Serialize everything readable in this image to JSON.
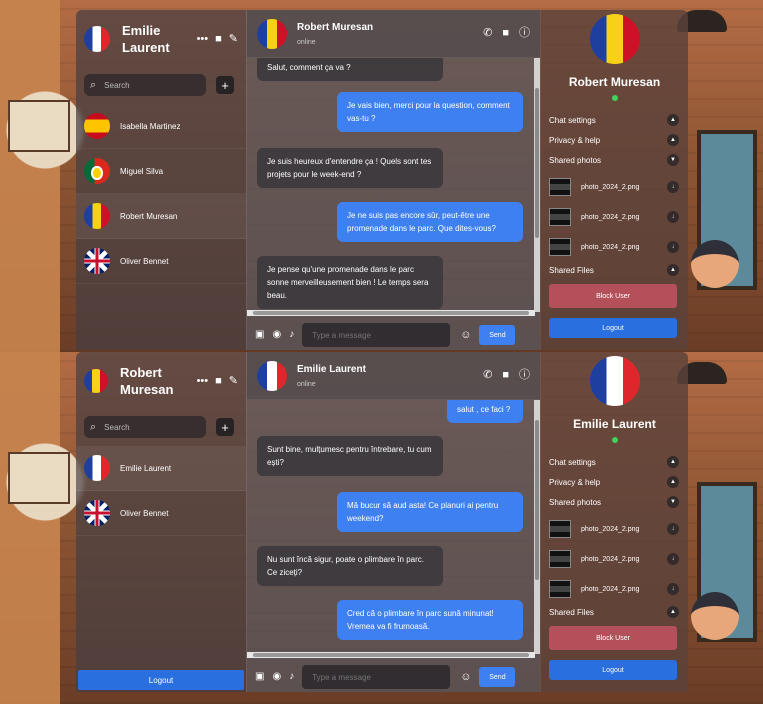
{
  "top": {
    "me": {
      "name": "Emilie Laurent",
      "flag": "fr"
    },
    "search_placeholder": "Search",
    "contacts": [
      {
        "name": "Isabella Martinez",
        "flag": "es"
      },
      {
        "name": "Miguel Silva",
        "flag": "pt"
      },
      {
        "name": "Robert Muresan",
        "flag": "ro"
      },
      {
        "name": "Oliver Bennet",
        "flag": "uk"
      }
    ],
    "chat": {
      "name": "Robert Muresan",
      "status": "online",
      "flag": "ro"
    },
    "messages": [
      {
        "dir": "in",
        "text": "Salut, comment ça va ?"
      },
      {
        "dir": "out",
        "text": "Je vais bien, merci pour la question, comment vas-tu ?"
      },
      {
        "dir": "in",
        "text": "Je suis heureux d'entendre ça ! Quels sont tes projets pour le week-end ?"
      },
      {
        "dir": "out",
        "text": "Je ne suis pas encore sûr, peut-être une promenade dans le parc. Que dites-vous?"
      },
      {
        "dir": "in",
        "text": "Je pense qu'une promenade dans le parc sonne merveilleusement bien ! Le temps sera beau."
      }
    ],
    "composer_placeholder": "Type a message",
    "send_label": "Send",
    "profile": {
      "name": "Robert Muresan",
      "flag": "ro"
    }
  },
  "bottom": {
    "me": {
      "name": "Robert Muresan",
      "flag": "ro"
    },
    "search_placeholder": "Search",
    "contacts": [
      {
        "name": "Emilie Laurent",
        "flag": "fr"
      },
      {
        "name": "Oliver Bennet",
        "flag": "uk"
      }
    ],
    "left_logout": "Logout",
    "chat": {
      "name": "Emilie Laurent",
      "status": "online",
      "flag": "fr"
    },
    "messages": [
      {
        "dir": "out",
        "text": "salut , ce faci ?"
      },
      {
        "dir": "in",
        "text": "Sunt bine, mulțumesc pentru întrebare, tu cum ești?"
      },
      {
        "dir": "out",
        "text": "Mă bucur să aud asta! Ce planuri ai pentru weekend?"
      },
      {
        "dir": "in",
        "text": "Nu sunt încă sigur, poate o plimbare în parc. Ce ziceți?"
      },
      {
        "dir": "out",
        "text": "Cred că o plimbare în parc sună minunat! Vremea va fi frumoasă."
      }
    ],
    "composer_placeholder": "Type a message",
    "send_label": "Send",
    "profile": {
      "name": "Emilie Laurent",
      "flag": "fr"
    }
  },
  "side": {
    "chat_settings": "Chat settings",
    "privacy_help": "Privacy & help",
    "shared_photos": "Shared photos",
    "photos": [
      "photo_2024_2.png",
      "photo_2024_2.png",
      "photo_2024_2.png"
    ],
    "shared_files": "Shared Files",
    "block_user": "Block User",
    "logout": "Logout"
  },
  "icons": {
    "more": "more-dots-icon",
    "video": "video-icon",
    "compose": "compose-icon",
    "phone": "phone-icon",
    "info": "info-icon",
    "search": "search-icon",
    "image": "image-icon",
    "camera": "camera-icon",
    "mic": "mic-icon",
    "emoji": "emoji-icon"
  },
  "colors": {
    "accent": "#3f80f0",
    "block": "#b4505a",
    "online": "#3cd45a"
  }
}
